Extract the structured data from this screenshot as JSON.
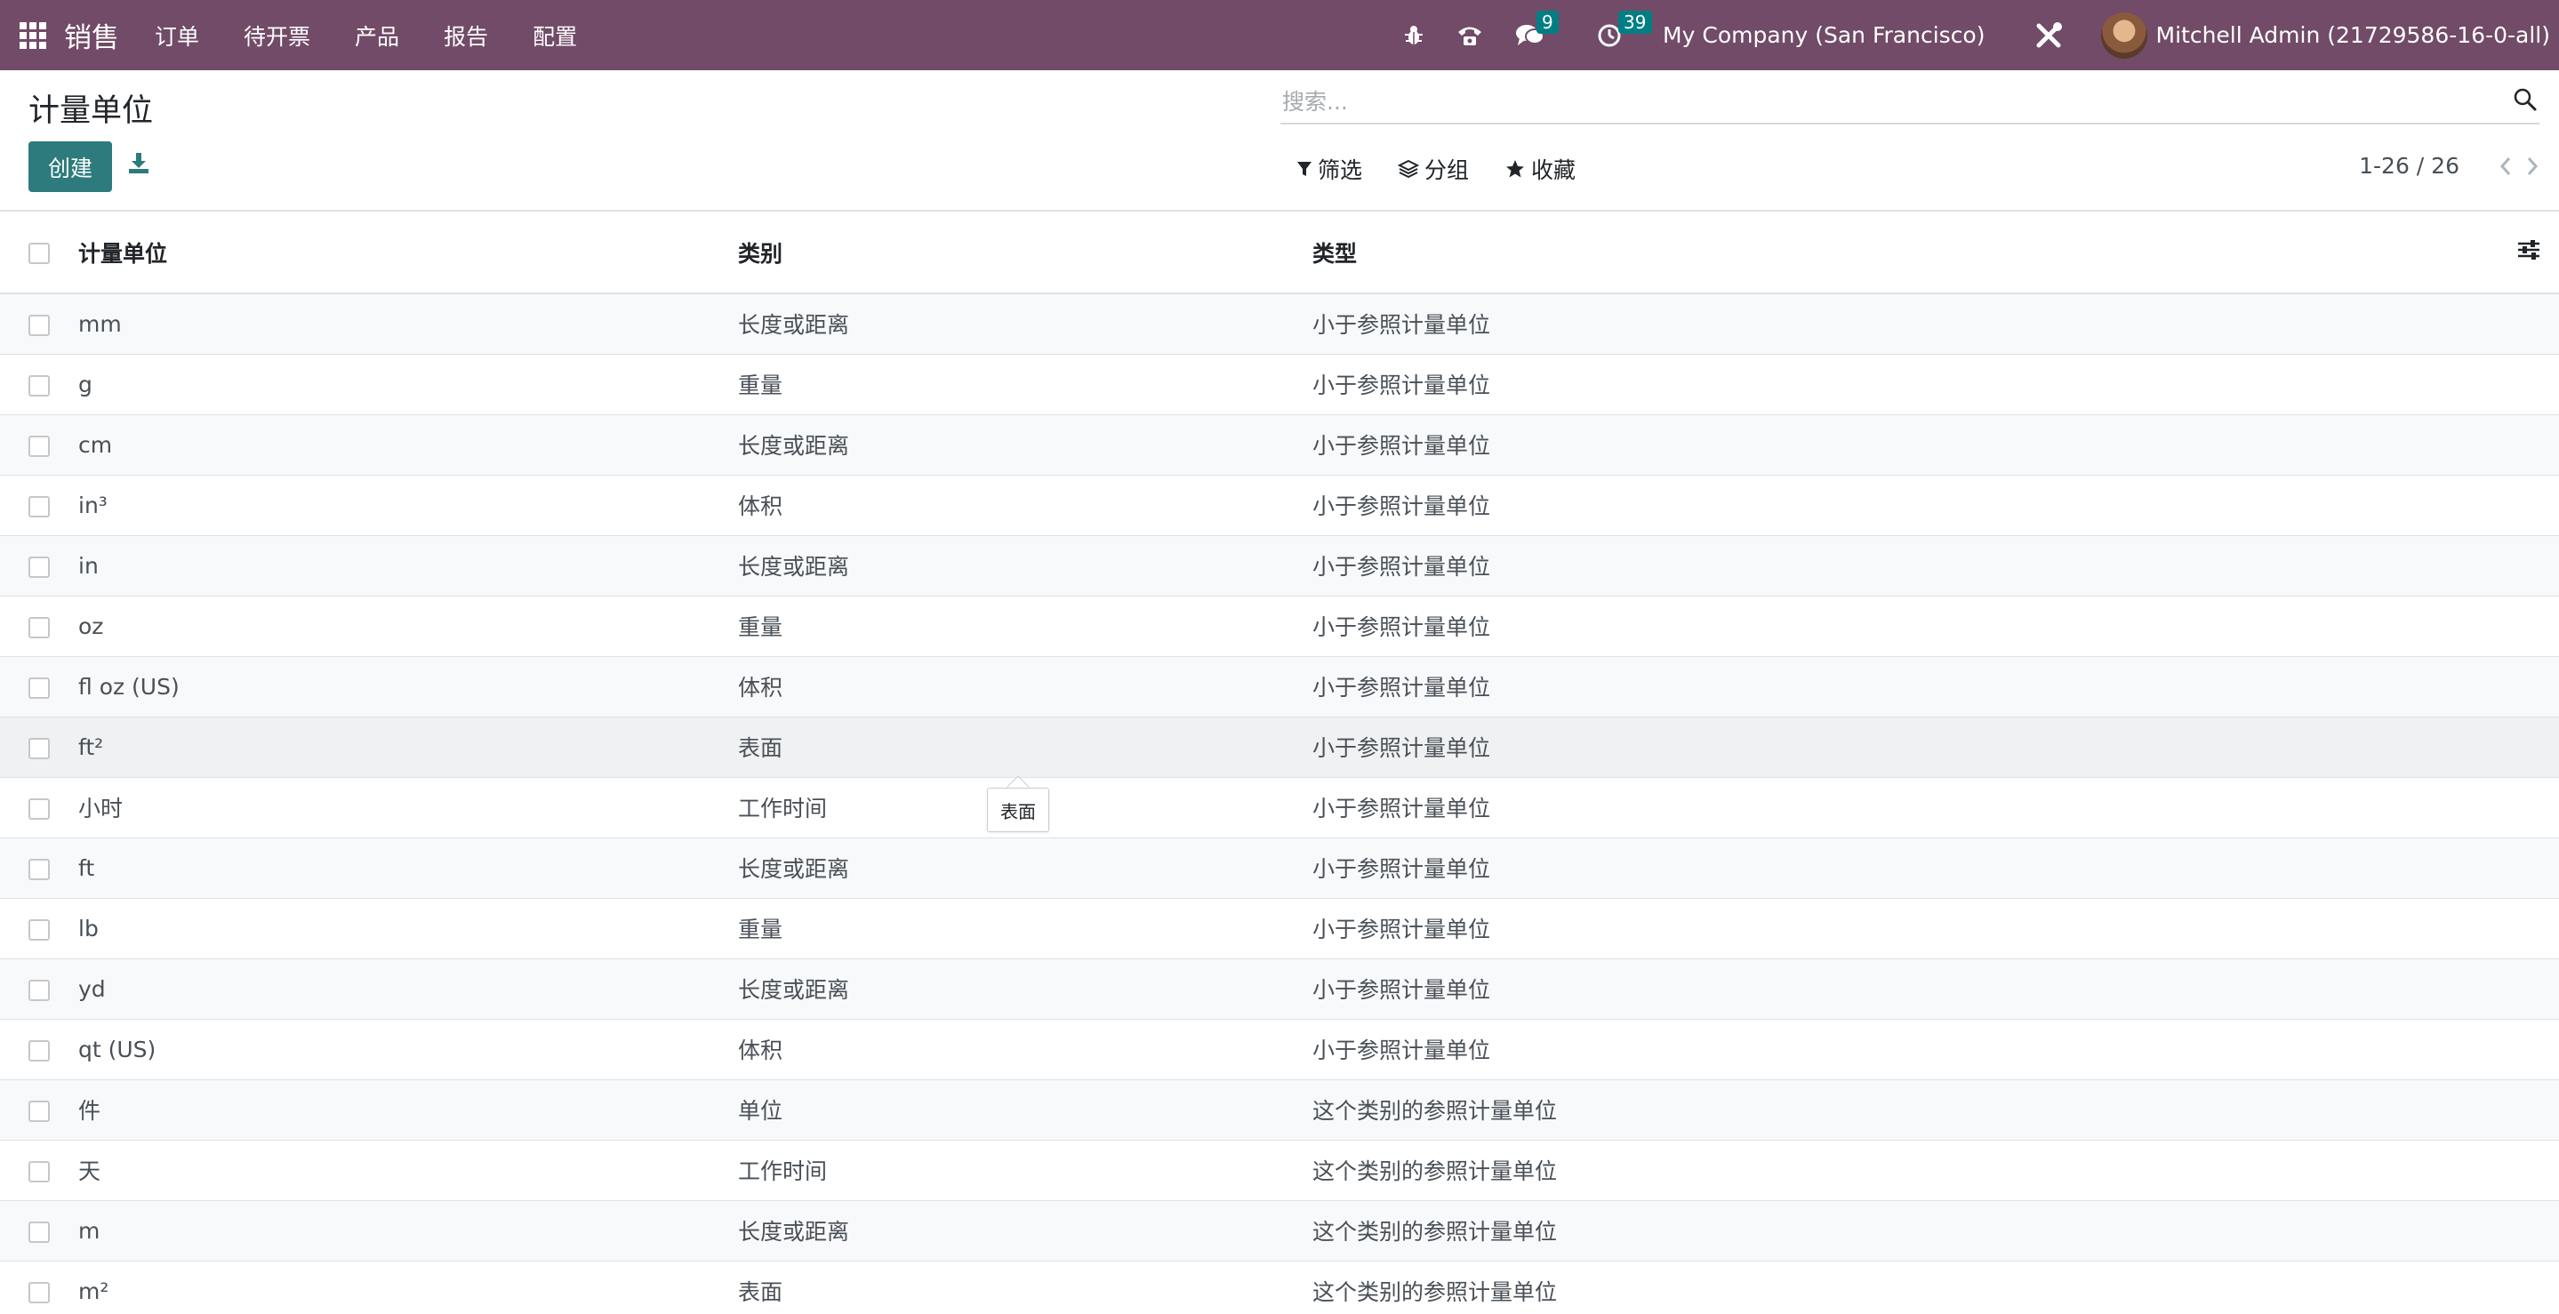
{
  "navbar": {
    "app_name": "销售",
    "menu": [
      "订单",
      "待开票",
      "产品",
      "报告",
      "配置"
    ],
    "messages_count": "9",
    "activities_count": "39",
    "company": "My Company (San Francisco)",
    "user": "Mitchell Admin (21729586-16-0-all)",
    "bg_color": "#714b67",
    "icons": [
      "apps-icon",
      "bug-icon",
      "phone-icon",
      "chat-icon",
      "clock-icon",
      "tools-icon"
    ]
  },
  "page": {
    "title": "计量单位",
    "create_label": "创建"
  },
  "search": {
    "placeholder": "搜索..."
  },
  "filters": {
    "filter_label": "筛选",
    "group_label": "分组",
    "favorites_label": "收藏"
  },
  "pager": {
    "value": "1-26 / 26"
  },
  "table": {
    "headers": {
      "name": "计量单位",
      "category": "类别",
      "type": "类型"
    },
    "rows": [
      {
        "name": "mm",
        "category": "长度或距离",
        "type": "小于参照计量单位"
      },
      {
        "name": "g",
        "category": "重量",
        "type": "小于参照计量单位"
      },
      {
        "name": "cm",
        "category": "长度或距离",
        "type": "小于参照计量单位"
      },
      {
        "name": "in³",
        "category": "体积",
        "type": "小于参照计量单位"
      },
      {
        "name": "in",
        "category": "长度或距离",
        "type": "小于参照计量单位"
      },
      {
        "name": "oz",
        "category": "重量",
        "type": "小于参照计量单位"
      },
      {
        "name": "fl oz (US)",
        "category": "体积",
        "type": "小于参照计量单位"
      },
      {
        "name": "ft²",
        "category": "表面",
        "type": "小于参照计量单位"
      },
      {
        "name": "小时",
        "category": "工作时间",
        "type": "小于参照计量单位"
      },
      {
        "name": "ft",
        "category": "长度或距离",
        "type": "小于参照计量单位"
      },
      {
        "name": "lb",
        "category": "重量",
        "type": "小于参照计量单位"
      },
      {
        "name": "yd",
        "category": "长度或距离",
        "type": "小于参照计量单位"
      },
      {
        "name": "qt (US)",
        "category": "体积",
        "type": "小于参照计量单位"
      },
      {
        "name": "件",
        "category": "单位",
        "type": "这个类别的参照计量单位"
      },
      {
        "name": "天",
        "category": "工作时间",
        "type": "这个类别的参照计量单位"
      },
      {
        "name": "m",
        "category": "长度或距离",
        "type": "这个类别的参照计量单位"
      },
      {
        "name": "m²",
        "category": "表面",
        "type": "这个类别的参照计量单位"
      }
    ]
  },
  "tooltip": {
    "text": "表面"
  },
  "colors": {
    "primary": "#2d7b7c",
    "badge": "#017e84"
  }
}
